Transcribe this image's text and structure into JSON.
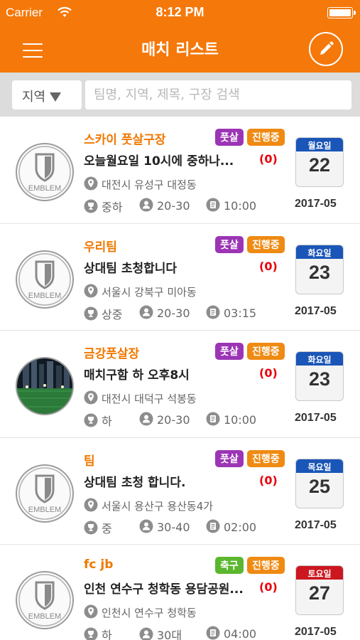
{
  "status_bar": {
    "carrier": "Carrier",
    "time": "8:12 PM",
    "battery_level": 1.0
  },
  "header": {
    "title": "매치 리스트",
    "menu_icon": "hamburger-icon",
    "edit_icon": "pencil-icon"
  },
  "search": {
    "region_label": "지역",
    "placeholder": "팀명, 지역, 제목, 구장 검색",
    "value": ""
  },
  "colors": {
    "brand": "#f5780a",
    "futsal_tag": "#9b35b5",
    "soccer_tag": "#5bb72e",
    "status_tag": "#ef8a12",
    "reply": "#e8000b",
    "weekday_header": "#1a55b8",
    "saturday_header": "#cc1720"
  },
  "matches": [
    {
      "team": "스카이 풋살구장",
      "sport": "풋살",
      "status": "진행중",
      "title": "오늘월요일  10시에  중하나...",
      "replies": "(0)",
      "location": "대전시 유성구 대정동",
      "level": "중하",
      "age": "20-30",
      "time": "10:00",
      "weekday": "월요일",
      "day": "22",
      "year_month": "2017-05",
      "emblem": "emblem-placeholder"
    },
    {
      "team": "우리팀",
      "sport": "풋살",
      "status": "진행중",
      "title": "상대팀 초청합니다",
      "replies": "(0)",
      "location": "서울시 강북구 미아동",
      "level": "상중",
      "age": "20-30",
      "time": "03:15",
      "weekday": "화요일",
      "day": "23",
      "year_month": "2017-05",
      "emblem": "emblem-placeholder"
    },
    {
      "team": "금강풋살장",
      "sport": "풋살",
      "status": "진행중",
      "title": "매치구함  하 오후8시",
      "replies": "(0)",
      "location": "대전시 대덕구 석봉동",
      "level": "하",
      "age": "20-30",
      "time": "10:00",
      "weekday": "화요일",
      "day": "23",
      "year_month": "2017-05",
      "emblem": "field-photo"
    },
    {
      "team": "팀",
      "sport": "풋살",
      "status": "진행중",
      "title": "상대팀 초청 합니다.",
      "replies": "(0)",
      "location": "서울시 용산구 용산동4가",
      "level": "중",
      "age": "30-40",
      "time": "02:00",
      "weekday": "목요일",
      "day": "25",
      "year_month": "2017-05",
      "emblem": "emblem-placeholder"
    },
    {
      "team": "fc jb",
      "sport": "축구",
      "status": "진행중",
      "title": "인천 연수구 청학동 용담공원...",
      "replies": "(0)",
      "location": "인천시 연수구 청학동",
      "level": "하",
      "age": "30대",
      "time": "04:00",
      "weekday": "토요일",
      "day": "27",
      "year_month": "2017-05",
      "emblem": "emblem-placeholder"
    }
  ]
}
